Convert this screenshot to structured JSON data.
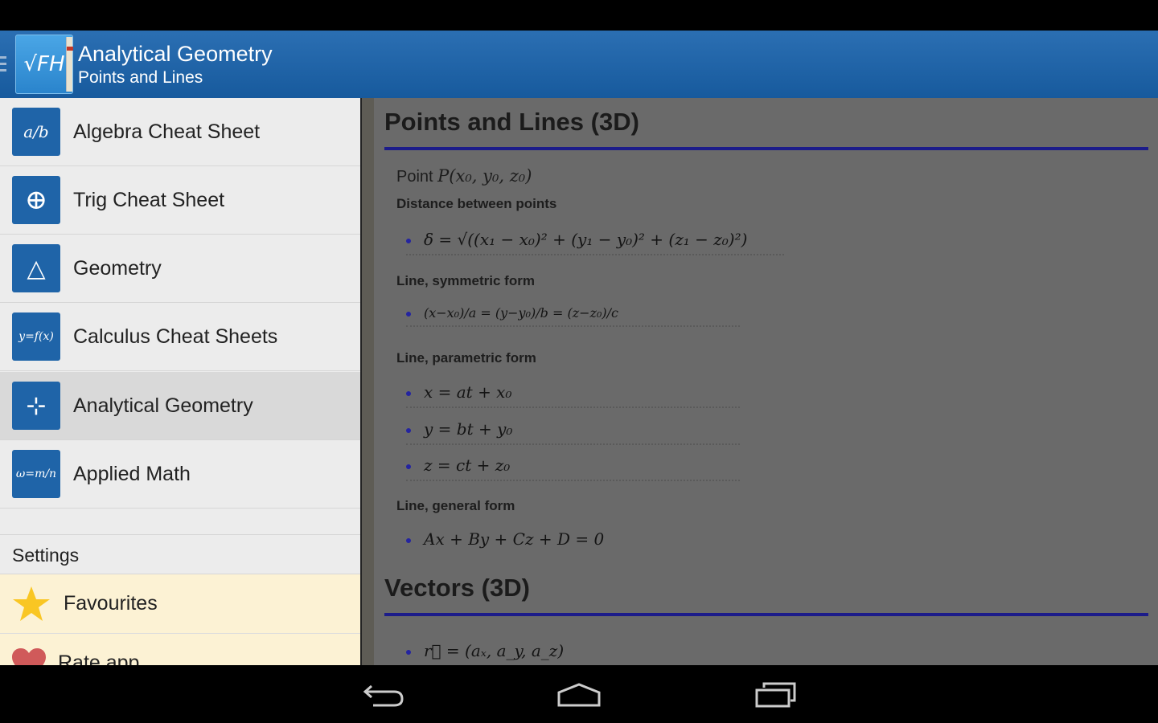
{
  "actionbar": {
    "title": "Analytical Geometry",
    "subtitle": "Points and Lines",
    "logo_text": "√FH"
  },
  "drawer": {
    "items": [
      {
        "label": "Algebra Cheat Sheet",
        "icon": "fraction-icon",
        "glyph": "a/b"
      },
      {
        "label": "Trig Cheat Sheet",
        "icon": "trig-quadrants-icon",
        "glyph": "⊕"
      },
      {
        "label": "Geometry",
        "icon": "triangle-icon",
        "glyph": "△"
      },
      {
        "label": "Calculus Cheat Sheets",
        "icon": "function-icon",
        "glyph": "y=f(x)"
      },
      {
        "label": "Analytical Geometry",
        "icon": "axes-icon",
        "glyph": "⊹",
        "selected": true
      },
      {
        "label": "Applied Math",
        "icon": "omega-icon",
        "glyph": "ω=m/n"
      }
    ],
    "settings_label": "Settings",
    "favourites_label": "Favourites",
    "rate_label": "Rate app"
  },
  "content": {
    "section1": "Points and Lines (3D)",
    "point_label": "Point",
    "point_formula": "P(x₀, y₀, z₀)",
    "distance_label": "Distance between points",
    "distance_formula": "δ = √((x₁ − x₀)² + (y₁ − y₀)² + (z₁ − z₀)²)",
    "symmetric_label": "Line, symmetric form",
    "symmetric_formula": "(x−x₀)/a = (y−y₀)/b = (z−z₀)/c",
    "parametric_label": "Line, parametric form",
    "parametric": [
      "x = at + x₀",
      "y = bt + y₀",
      "z = ct + z₀"
    ],
    "general_label": "Line, general form",
    "general_formula": "Ax + By + Cz + D = 0",
    "section2": "Vectors (3D)",
    "vector_formula": "r⃗ = (aₓ, a_y, a_z)"
  },
  "colors": {
    "actionbar": "#2366aa",
    "rule": "#1c1c8a",
    "favourites_bg": "#fcf2d4",
    "star": "#f9c623",
    "heart": "#d05a5a"
  }
}
